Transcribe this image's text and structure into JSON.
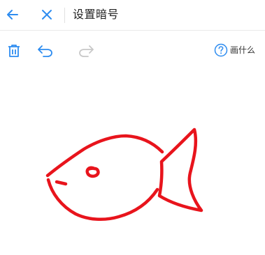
{
  "header": {
    "title": "设置暗号",
    "back_icon": "arrow-left-icon",
    "close_icon": "close-icon"
  },
  "toolbar": {
    "delete_icon": "trash-icon",
    "undo_icon": "undo-icon",
    "redo_icon": "redo-icon",
    "redo_enabled": false,
    "help_icon": "question-circle-icon",
    "help_label": "画什么"
  },
  "canvas": {
    "drawing": "fish",
    "stroke_color": "#e8141c"
  },
  "colors": {
    "accent": "#2d8cf0",
    "disabled": "#c8c8c8",
    "text": "#222222"
  }
}
